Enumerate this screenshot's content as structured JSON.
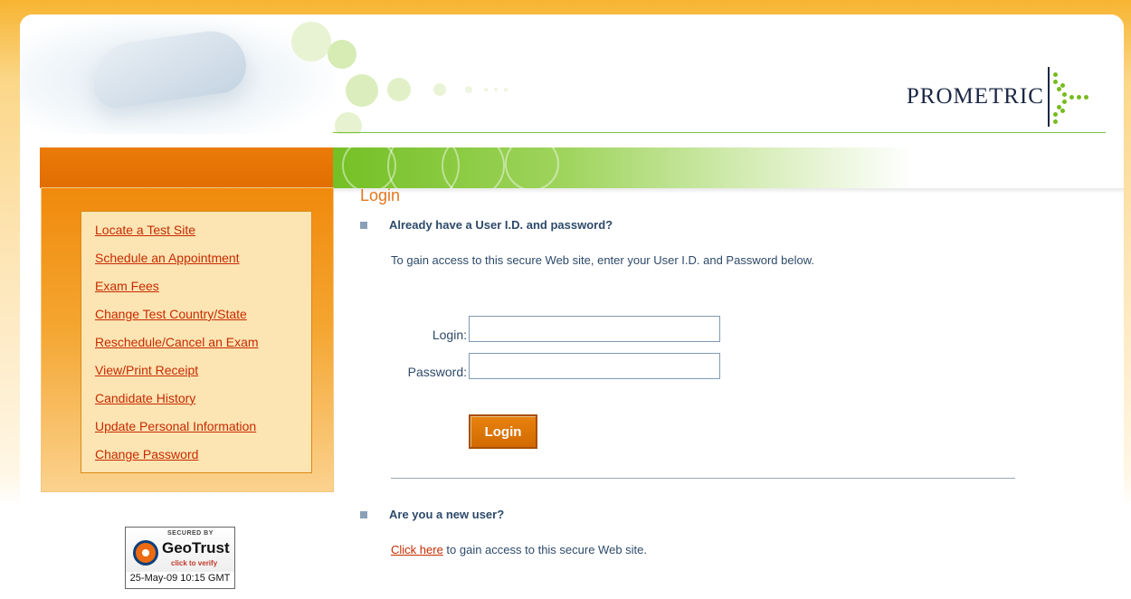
{
  "header": {
    "logo_text": "PROMETRIC",
    "colors": {
      "orange": "#e06d00",
      "green": "#74c025",
      "navy": "#1a2744"
    }
  },
  "sidebar": {
    "items": [
      {
        "label": "Locate a Test Site"
      },
      {
        "label": "Schedule an Appointment"
      },
      {
        "label": "Exam Fees"
      },
      {
        "label": "Change Test Country/State"
      },
      {
        "label": "Reschedule/Cancel an Exam"
      },
      {
        "label": "View/Print Receipt"
      },
      {
        "label": "Candidate History"
      },
      {
        "label": "Update Personal Information"
      },
      {
        "label": "Change Password"
      }
    ]
  },
  "main": {
    "title": "Login",
    "existing_user_heading": "Already have a User I.D. and password?",
    "existing_user_intro": "To gain access to this secure Web site, enter your User I.D. and Password below.",
    "login_label": "Login:",
    "login_value": "",
    "password_label": "Password:",
    "password_value": "",
    "login_button": "Login",
    "new_user_heading": "Are you a new user?",
    "new_user_link": "Click here",
    "new_user_text": " to gain access to this secure Web site."
  },
  "geotrust": {
    "secured_by": "SECURED BY",
    "name": "GeoTrust",
    "verify": "click to verify",
    "date": "25-May-09 10:15 GMT"
  }
}
